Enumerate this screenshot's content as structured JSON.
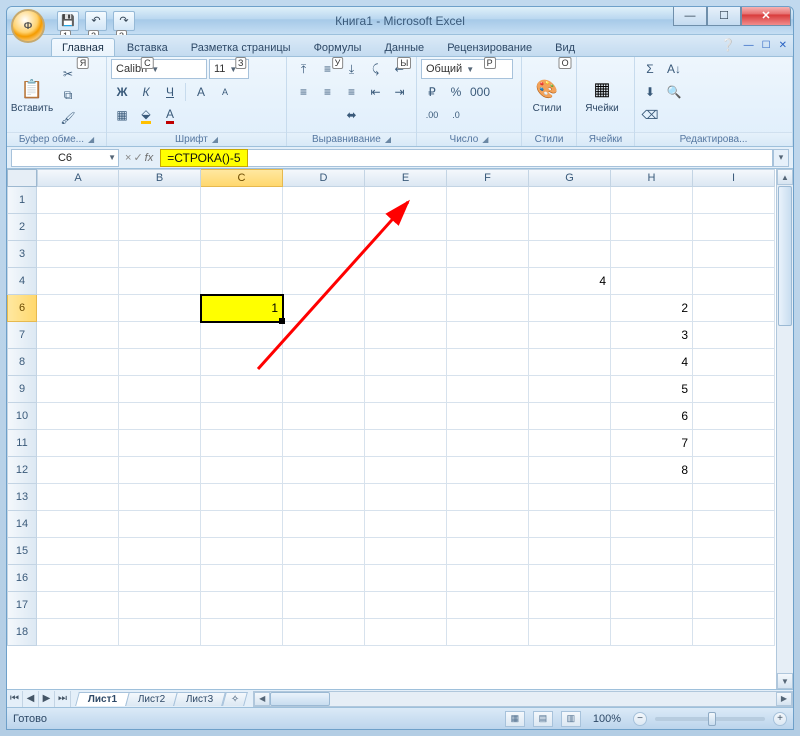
{
  "title": "Книга1 - Microsoft Excel",
  "office_letter": "Ф",
  "qat_keys": [
    "1",
    "2",
    "3"
  ],
  "tabs": {
    "items": [
      {
        "label": "Главная",
        "key": "Я",
        "active": true
      },
      {
        "label": "Вставка",
        "key": "С"
      },
      {
        "label": "Разметка страницы",
        "key": "З"
      },
      {
        "label": "Формулы",
        "key": "У"
      },
      {
        "label": "Данные",
        "key": "Ы"
      },
      {
        "label": "Рецензирование",
        "key": "Р"
      },
      {
        "label": "Вид",
        "key": "О"
      }
    ]
  },
  "ribbon": {
    "clipboard": {
      "paste": "Вставить",
      "label": "Буфер обме..."
    },
    "font": {
      "name": "Calibri",
      "size": "11",
      "label": "Шрифт",
      "bold": "Ж",
      "italic": "К",
      "underline": "Ч"
    },
    "align": {
      "label": "Выравнивание"
    },
    "number": {
      "format": "Общий",
      "label": "Число"
    },
    "styles": {
      "label": "Стили"
    },
    "cells": {
      "label": "Ячейки"
    },
    "editing": {
      "label": "Редактирова..."
    }
  },
  "name_box": "C6",
  "formula": "=СТРОКА()-5",
  "columns": [
    "A",
    "B",
    "C",
    "D",
    "E",
    "F",
    "G",
    "H",
    "I"
  ],
  "rows": [
    "1",
    "2",
    "3",
    "4",
    "6",
    "7",
    "8",
    "9",
    "10",
    "11",
    "12",
    "13",
    "14",
    "15",
    "16",
    "17",
    "18"
  ],
  "cells": {
    "G4": "4",
    "C6": "1",
    "H6": "2",
    "H7": "3",
    "H8": "4",
    "H9": "5",
    "H10": "6",
    "H11": "7",
    "H12": "8"
  },
  "active_cell": "C6",
  "sheets": {
    "items": [
      "Лист1",
      "Лист2",
      "Лист3"
    ],
    "active": 0
  },
  "status": "Готово",
  "zoom": "100%"
}
